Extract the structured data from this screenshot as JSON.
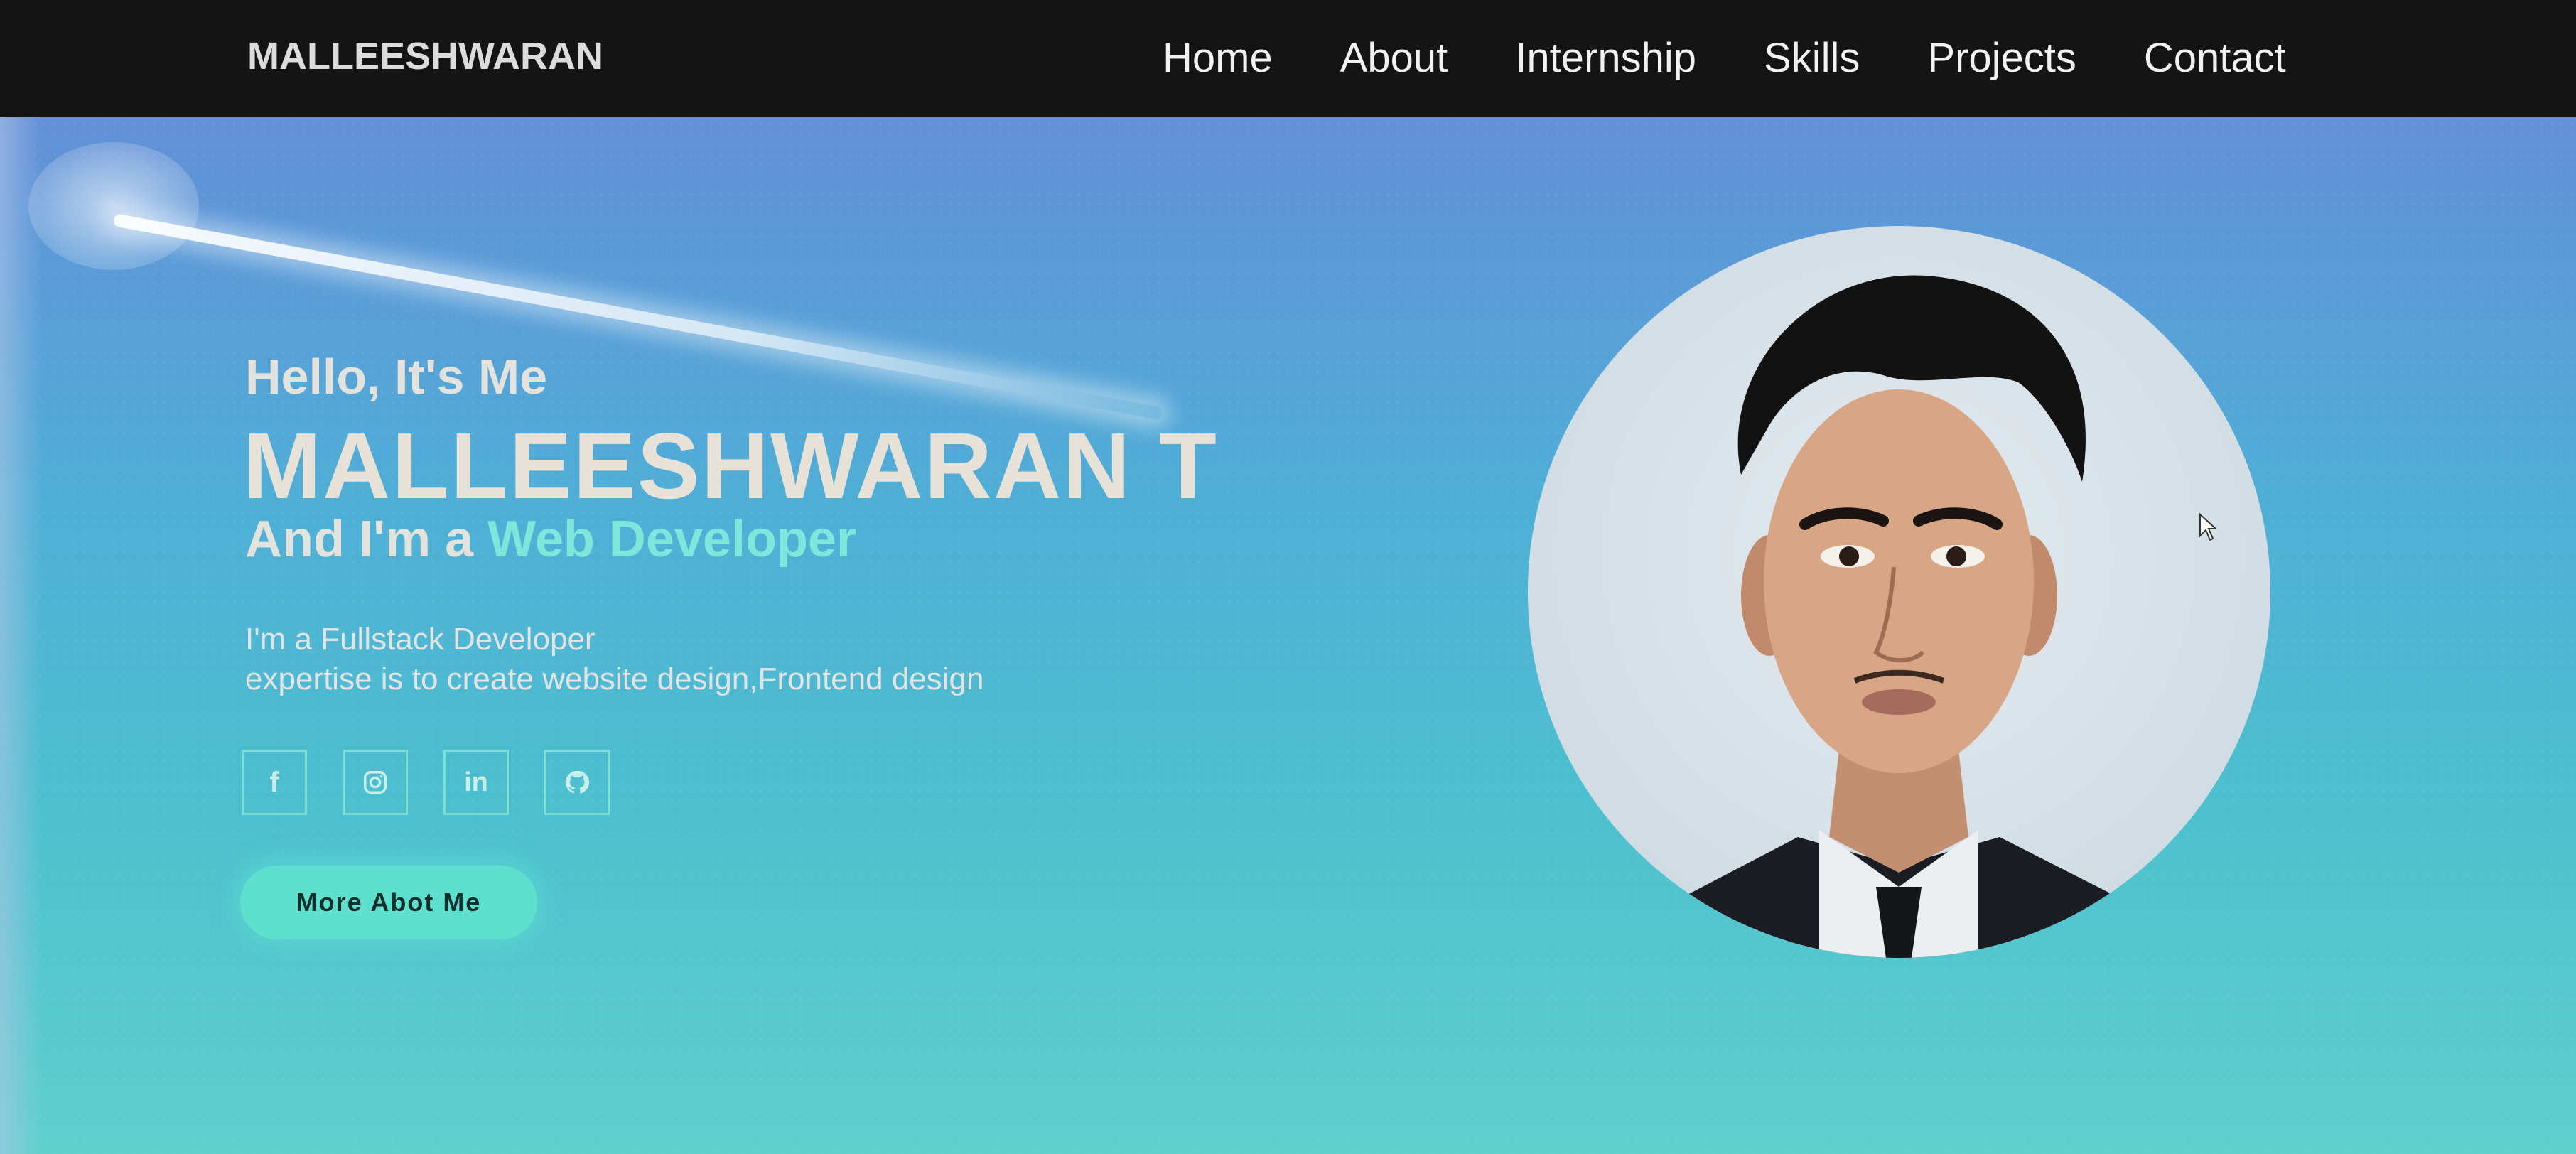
{
  "navbar": {
    "brand": "MALLEESHWARAN",
    "links": [
      {
        "label": "Home"
      },
      {
        "label": "About"
      },
      {
        "label": "Internship"
      },
      {
        "label": "Skills"
      },
      {
        "label": "Projects"
      },
      {
        "label": "Contact"
      }
    ]
  },
  "hero": {
    "greeting": "Hello, It's Me",
    "name": "MALLEESHWARAN T",
    "role_prefix": "And I'm a ",
    "role_accent": "Web Developer",
    "desc_line1": "I'm a Fullstack Developer",
    "desc_line2": "expertise is to create website design,Frontend design",
    "socials": [
      {
        "icon": "facebook-icon",
        "glyph": "f"
      },
      {
        "icon": "instagram-icon"
      },
      {
        "icon": "linkedin-icon",
        "glyph": "in"
      },
      {
        "icon": "github-icon"
      }
    ],
    "cta_label": "More Abot Me"
  },
  "colors": {
    "navbar_bg": "#141414",
    "accent": "#7fe6dc",
    "button_bg": "#5fe0cf"
  }
}
